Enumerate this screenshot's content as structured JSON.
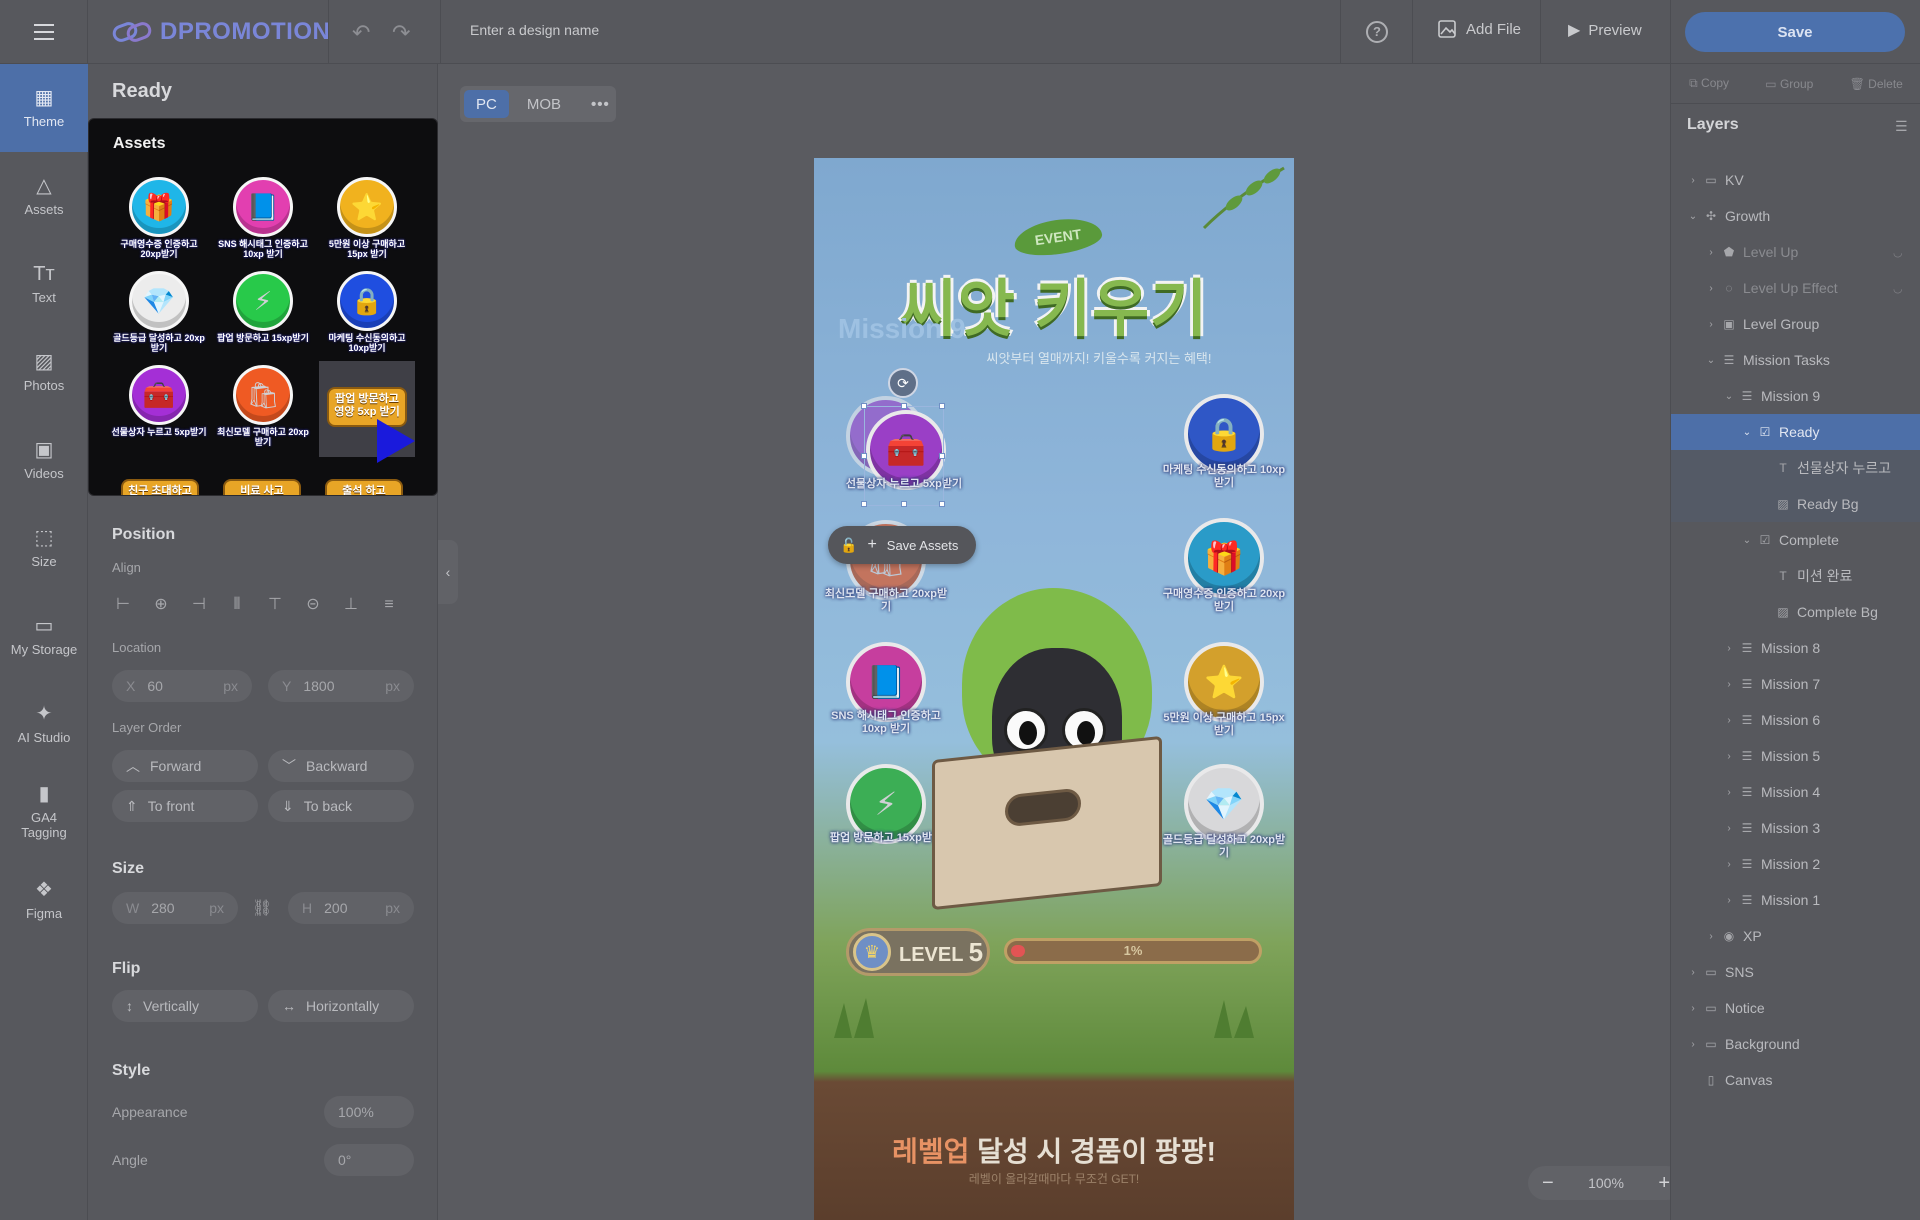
{
  "topbar": {
    "logo_text": "DPROMOTION",
    "design_name_placeholder": "Enter a design name",
    "help_label": "?",
    "add_file_label": "Add File",
    "preview_label": "Preview",
    "save_label": "Save"
  },
  "leftnav": {
    "items": [
      {
        "label": "Theme",
        "icon": "theme-icon"
      },
      {
        "label": "Assets",
        "icon": "shapes-icon"
      },
      {
        "label": "Text",
        "icon": "text-icon"
      },
      {
        "label": "Photos",
        "icon": "image-icon"
      },
      {
        "label": "Videos",
        "icon": "video-icon"
      },
      {
        "label": "Size",
        "icon": "resize-icon"
      },
      {
        "label": "My Storage",
        "icon": "folder-icon"
      },
      {
        "label": "AI Studio",
        "icon": "wand-icon"
      },
      {
        "label": "GA4 Tagging",
        "icon": "chart-icon"
      },
      {
        "label": "Figma",
        "icon": "figma-icon"
      }
    ]
  },
  "panel": {
    "title": "Ready",
    "position_h": "Position",
    "align_h": "Align",
    "location_h": "Location",
    "x_key": "X",
    "x_value": "60",
    "x_unit": "px",
    "y_key": "Y",
    "y_value": "1800",
    "y_unit": "px",
    "layer_order_h": "Layer Order",
    "forward": "Forward",
    "backward": "Backward",
    "to_front": "To front",
    "to_back": "To back",
    "size_h": "Size",
    "w_key": "W",
    "w_value": "280",
    "w_unit": "px",
    "h_key": "H",
    "h_value": "200",
    "h_unit": "px",
    "flip_h": "Flip",
    "vertically": "Vertically",
    "horizontally": "Horizontally",
    "style_h": "Style",
    "appearance_label": "Appearance",
    "appearance_value": "100%",
    "angle_label": "Angle",
    "angle_value": "0°"
  },
  "assets": {
    "title": "Assets",
    "items": [
      {
        "caption": "구매영수증 인증하고 20xp받기",
        "icon": "gift-icon",
        "color": "#1fb6e8"
      },
      {
        "caption": "SNS 해시태그 인증하고 10xp 받기",
        "icon": "book-icon",
        "color": "#e23fb0"
      },
      {
        "caption": "5만원 이상 구매하고 15px 받기",
        "icon": "coin-icon",
        "color": "#f1b21e"
      },
      {
        "caption": "골드등급 달성하고 20xp받기",
        "icon": "gem-icon",
        "color": "#ececec"
      },
      {
        "caption": "팝업 방문하고 15xp받기",
        "icon": "bolt-icon",
        "color": "#28c94a"
      },
      {
        "caption": "마케팅 수신동의하고 10xp받기",
        "icon": "lock-icon",
        "color": "#1f4ee0"
      },
      {
        "caption": "선물상자 누르고 5xp받기",
        "icon": "chest-icon",
        "color": "#a42fd6"
      },
      {
        "caption": "최신모델 구매하고 20xp받기",
        "icon": "bag-icon",
        "color": "#ef5a23"
      }
    ],
    "tag_selected": "팝업 방문하고 영양 5xp 받기",
    "tags_bottom": [
      "친구 초대하고",
      "비료 사고",
      "출석 하고"
    ]
  },
  "canvas": {
    "view_pc": "PC",
    "view_mob": "MOB",
    "view_more": "•••",
    "event": "EVENT",
    "title": "씨앗 키우기",
    "mission_label": "Mission 9",
    "subtitle": "씨앗부터 열매까지! 키울수록 커지는 혜택!",
    "missions_left": [
      {
        "caption": "선물상자 누르고 5xp받기",
        "color": "#9a3fc6",
        "icon": "chest-icon"
      },
      {
        "caption": "최신모델 구매하고 20xp받기",
        "color": "#d9582b",
        "icon": "bag-icon"
      },
      {
        "caption": "SNS 해시태그 인증하고 10xp 받기",
        "color": "#c63e9e",
        "icon": "book-icon"
      },
      {
        "caption": "팝업 방문하고 15xp받기",
        "color": "#3cae55",
        "icon": "bolt-icon"
      }
    ],
    "missions_right": [
      {
        "caption": "마케팅 수신동의하고 10xp받기",
        "color": "#2f57c6",
        "icon": "lock-icon"
      },
      {
        "caption": "구매영수증 인증하고 20xp받기",
        "color": "#2a9bc8",
        "icon": "gift-icon"
      },
      {
        "caption": "5만원 이상 구매하고 15px 받기",
        "color": "#d3a02c",
        "icon": "coin-icon"
      },
      {
        "caption": "골드등급 달성하고 20xp받기",
        "color": "#d8d8da",
        "icon": "gem-icon"
      }
    ],
    "save_assets": "Save Assets",
    "level_word": "LEVEL",
    "level_num": "5",
    "xp_percent_label": "1%",
    "xp_progress": 0.01,
    "bottom_title_hl": "레벨업",
    "bottom_title_rest": " 달성 시 경품이 팡팡!",
    "bottom_sub": "레벨이 올라갈때마다 무조건 GET!",
    "zoom_minus": "−",
    "zoom_value": "100%",
    "zoom_plus": "+"
  },
  "rightpanel": {
    "copy": "Copy",
    "group": "Group",
    "delete": "Delete",
    "layers_h": "Layers",
    "layers": [
      {
        "label": "KV",
        "icon": "folder-icon",
        "depth": 0,
        "chev": "›"
      },
      {
        "label": "Growth",
        "icon": "sparkle-icon",
        "depth": 0,
        "chev": "⌄"
      },
      {
        "label": "Level Up",
        "icon": "badge-icon",
        "depth": 1,
        "chev": "›",
        "dim": true
      },
      {
        "label": "Level Up Effect",
        "icon": "effect-icon",
        "depth": 1,
        "chev": "›",
        "dim": true
      },
      {
        "label": "Level Group",
        "icon": "group-icon",
        "depth": 1,
        "chev": "›"
      },
      {
        "label": "Mission Tasks",
        "icon": "list-icon",
        "depth": 1,
        "chev": "⌄"
      },
      {
        "label": "Mission 9",
        "icon": "list-icon",
        "depth": 2,
        "chev": "⌄"
      },
      {
        "label": "Ready",
        "icon": "check-icon",
        "depth": 3,
        "chev": "⌄",
        "selected": true
      },
      {
        "label": "선물상자 누르고",
        "icon": "text-icon",
        "depth": 4,
        "chev": "",
        "sub": true
      },
      {
        "label": "Ready Bg",
        "icon": "image-icon",
        "depth": 4,
        "chev": "",
        "sub": true
      },
      {
        "label": "Complete",
        "icon": "check-icon",
        "depth": 3,
        "chev": "⌄"
      },
      {
        "label": "미션 완료",
        "icon": "text-icon",
        "depth": 4,
        "chev": ""
      },
      {
        "label": "Complete Bg",
        "icon": "image-icon",
        "depth": 4,
        "chev": ""
      },
      {
        "label": "Mission 8",
        "icon": "list-icon",
        "depth": 2,
        "chev": "›"
      },
      {
        "label": "Mission 7",
        "icon": "list-icon",
        "depth": 2,
        "chev": "›"
      },
      {
        "label": "Mission 6",
        "icon": "list-icon",
        "depth": 2,
        "chev": "›"
      },
      {
        "label": "Mission 5",
        "icon": "list-icon",
        "depth": 2,
        "chev": "›"
      },
      {
        "label": "Mission 4",
        "icon": "list-icon",
        "depth": 2,
        "chev": "›"
      },
      {
        "label": "Mission 3",
        "icon": "list-icon",
        "depth": 2,
        "chev": "›"
      },
      {
        "label": "Mission 2",
        "icon": "list-icon",
        "depth": 2,
        "chev": "›"
      },
      {
        "label": "Mission 1",
        "icon": "list-icon",
        "depth": 2,
        "chev": "›"
      },
      {
        "label": "XP",
        "icon": "xp-icon",
        "depth": 1,
        "chev": "›"
      },
      {
        "label": "SNS",
        "icon": "folder-icon",
        "depth": 0,
        "chev": "›"
      },
      {
        "label": "Notice",
        "icon": "folder-icon",
        "depth": 0,
        "chev": "›"
      },
      {
        "label": "Background",
        "icon": "folder-icon",
        "depth": 0,
        "chev": "›"
      },
      {
        "label": "Canvas",
        "icon": "canvas-icon",
        "depth": 0,
        "chev": ""
      }
    ]
  }
}
